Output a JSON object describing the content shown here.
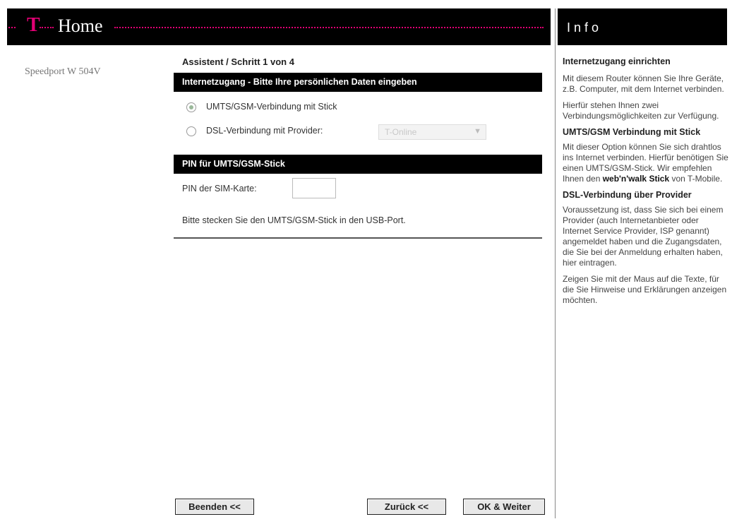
{
  "header": {
    "brand_word": "Home",
    "brand_letter": "T"
  },
  "info_header": {
    "title": "Info"
  },
  "device_name": "Speedport W 504V",
  "wizard": {
    "step_text": "Assistent / Schritt 1 von 4",
    "section1_title": "Internetzugang - Bitte Ihre persönlichen Daten eingeben",
    "options": [
      {
        "label": "UMTS/GSM-Verbindung mit Stick",
        "selected": true
      },
      {
        "label": "DSL-Verbindung mit Provider:",
        "selected": false
      }
    ],
    "provider_select": {
      "value": "T-Online",
      "disabled": true
    },
    "section2_title": "PIN für UMTS/GSM-Stick",
    "pin_label": "PIN der SIM-Karte:",
    "pin_value": "",
    "hint": "Bitte stecken Sie den UMTS/GSM-Stick in den USB-Port."
  },
  "buttons": {
    "cancel": "Beenden <<",
    "back": "Zurück <<",
    "next": "OK & Weiter"
  },
  "info": {
    "heading": "Internetzugang einrichten",
    "p1": "Mit diesem Router können Sie Ihre Geräte, z.B. Computer, mit dem Internet verbinden.",
    "p2": "Hierfür stehen Ihnen zwei Verbindungsmöglichkeiten zur Verfügung.",
    "umts_heading": "UMTS/GSM Verbindung mit Stick",
    "umts_text_before": "Mit dieser Option können Sie sich drahtlos ins Internet verbinden. Hierfür benötigen Sie einen UMTS/GSM-Stick. Wir empfehlen Ihnen den ",
    "umts_text_bold": "web'n'walk Stick",
    "umts_text_after": " von T-Mobile.",
    "dsl_heading": "DSL-Verbindung über Provider",
    "dsl_text": "Voraussetzung ist, dass Sie sich bei einem Provider (auch Internetanbieter oder Internet Service Provider, ISP genannt) angemeldet haben und die Zugangsdaten, die Sie bei der Anmeldung erhalten haben, hier eintragen.",
    "hover_text": "Zeigen Sie mit der Maus auf die Texte, für die Sie Hinweise und Erklärungen anzeigen möchten."
  },
  "colors": {
    "brand_magenta": "#e20074",
    "header_bg": "#000000",
    "radio_selected": "#9ab89a"
  }
}
